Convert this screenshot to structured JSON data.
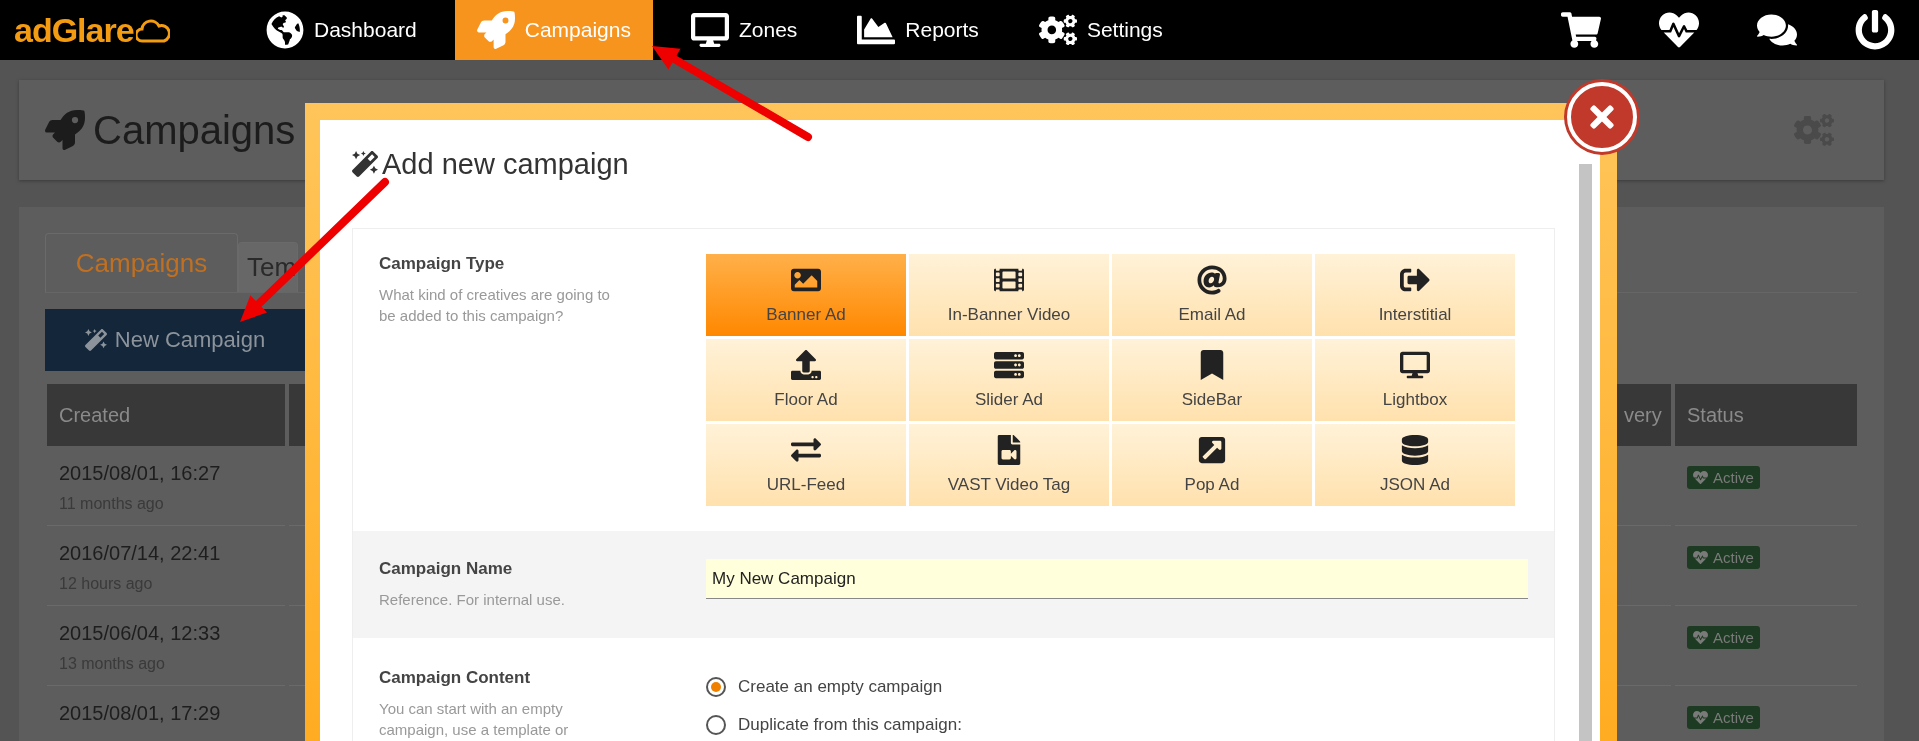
{
  "top_bar": {
    "logo": "adGlare",
    "nav": [
      {
        "label": "Dashboard",
        "selected": false
      },
      {
        "label": "Campaigns",
        "selected": true
      },
      {
        "label": "Zones",
        "selected": false
      },
      {
        "label": "Reports",
        "selected": false
      },
      {
        "label": "Settings",
        "selected": false
      }
    ]
  },
  "page_header": {
    "title": "Campaigns"
  },
  "tabs": [
    {
      "label": "Campaigns",
      "selected": true
    },
    {
      "label": "Tem",
      "selected": false
    }
  ],
  "new_button": "New Campaign",
  "table": {
    "columns": [
      "Created",
      "very",
      "Status"
    ],
    "rows": [
      {
        "created": "2015/08/01, 16:27",
        "ago": "11 months ago",
        "status": "Active"
      },
      {
        "created": "2016/07/14, 22:41",
        "ago": "12 hours ago",
        "status": "Active"
      },
      {
        "created": "2015/06/04, 12:33",
        "ago": "13 months ago",
        "status": "Active"
      },
      {
        "created": "2015/08/01, 17:29",
        "status": "Active"
      }
    ]
  },
  "modal": {
    "title": "Add new campaign",
    "campaign_type": {
      "label": "Campaign Type",
      "help": "What kind of creatives are going to be added to this campaign?",
      "options": [
        {
          "label": "Banner Ad",
          "selected": true
        },
        {
          "label": "In-Banner Video",
          "selected": false
        },
        {
          "label": "Email Ad",
          "selected": false
        },
        {
          "label": "Interstitial",
          "selected": false
        },
        {
          "label": "Floor Ad",
          "selected": false
        },
        {
          "label": "Slider Ad",
          "selected": false
        },
        {
          "label": "SideBar",
          "selected": false
        },
        {
          "label": "Lightbox",
          "selected": false
        },
        {
          "label": "URL-Feed",
          "selected": false
        },
        {
          "label": "VAST Video Tag",
          "selected": false
        },
        {
          "label": "Pop Ad",
          "selected": false
        },
        {
          "label": "JSON Ad",
          "selected": false
        }
      ]
    },
    "campaign_name": {
      "label": "Campaign Name",
      "help": "Reference. For internal use.",
      "value": "My New Campaign"
    },
    "campaign_content": {
      "label": "Campaign Content",
      "help": "You can start with an empty campaign, use a template or",
      "options": [
        {
          "label": "Create an empty campaign",
          "selected": true
        },
        {
          "label": "Duplicate from this campaign:",
          "selected": false
        }
      ]
    }
  }
}
